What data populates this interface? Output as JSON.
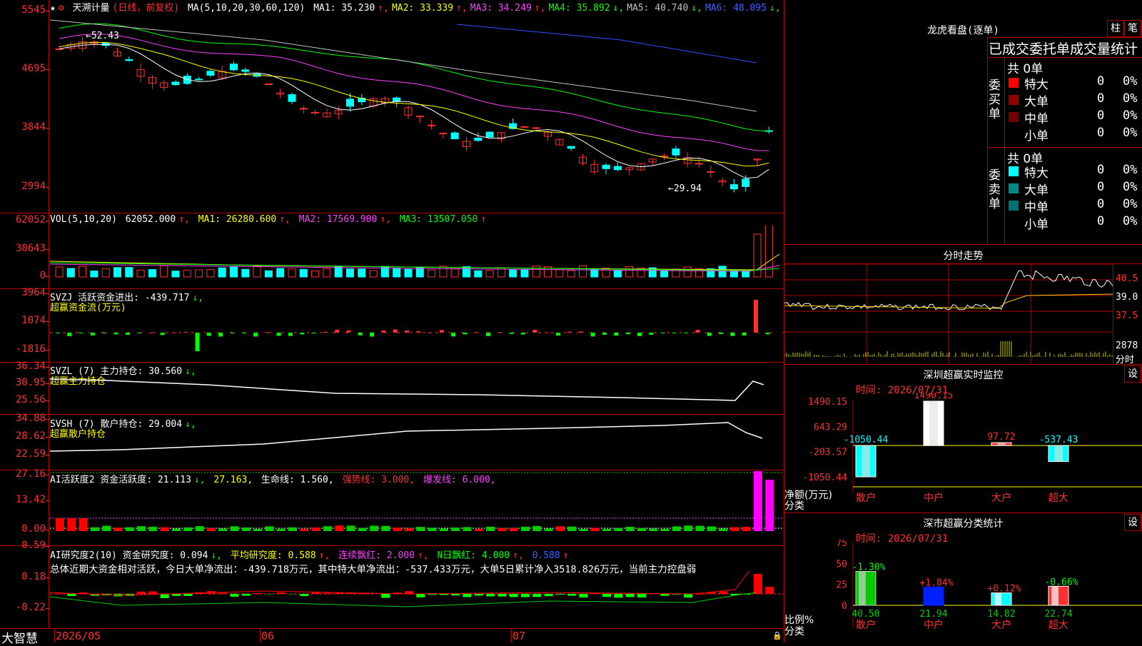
{
  "kline": {
    "star": "★",
    "title": "天溯计量",
    "mode": "(日线，前复权)",
    "ma_params": "MA(5,10,20,30,60,120)",
    "ma": [
      {
        "label": "MA1: 35.230",
        "arrow": "↑",
        "color": "#ffffff"
      },
      {
        "label": "MA2: 33.339",
        "arrow": "↑",
        "color": "#ffff00"
      },
      {
        "label": "MA3: 34.249",
        "arrow": "↑",
        "color": "#ff40ff"
      },
      {
        "label": "MA4: 35.892",
        "arrow": "↓",
        "color": "#00ff00"
      },
      {
        "label": "MA5: 40.740",
        "arrow": "↓",
        "color": "#c0c0c0"
      },
      {
        "label": "MA6: 48.095",
        "arrow": "↓",
        "color": "#4060ff"
      }
    ],
    "yticks": [
      "5545",
      "4695",
      "3844",
      "2994"
    ],
    "high_label": "52.43",
    "low_label": "29.94"
  },
  "vol": {
    "params": "VOL(5,10,20)",
    "value": "62052.000",
    "ma1": "MA1: 26280.600",
    "ma2": "MA2: 17569.900",
    "ma3": "MA3: 13507.050",
    "yticks": [
      "62052",
      "30643",
      "0"
    ]
  },
  "svzj": {
    "line1": "SVZJ  活跃资金进出: -439.717",
    "line1_arrow": "↓,",
    "line2": "超赢资金流(万元)",
    "yticks": [
      "3964",
      "1074",
      "-1816"
    ]
  },
  "svzl": {
    "line1": "SVZL (7) 主力持仓: 30.560",
    "line1_arrow": "↓,",
    "line2": "超赢主力持仓",
    "yticks": [
      "36.34",
      "30.95",
      "25.56"
    ]
  },
  "svsh": {
    "line1": "SVSH (7) 散户持仓: 29.004",
    "line1_arrow": "↓,",
    "line2": "超赢散户持仓",
    "yticks": [
      "34.88",
      "28.62",
      "22.59"
    ]
  },
  "ai1": {
    "label": "AI活跃度2 资金活跃度: 21.113",
    "arrow": "↓,",
    "v2": "27.163,",
    "v3": "生命线: 1.560,",
    "v4": "强势线: 3.000,",
    "v5": "爆发线: 6.000,",
    "yticks": [
      "27.16",
      "13.42",
      "0.00"
    ]
  },
  "ai2": {
    "label": "AI研究度2(10) 资金研究度: 0.094",
    "arrow": "↓,",
    "v2": "平均研究度: 0.588",
    "v2_arrow": "↑,",
    "v3": "连续飘红: 2.000",
    "v3_arrow": "↑,",
    "v4": "N日飘红: 4.000",
    "v4_arrow": "↑,",
    "v5": "0.588",
    "v5_arrow": "↑",
    "summary": "总体近期大资金相对活跃，今日大单净流出：-439.718万元，其中特大单净流出：-537.433万元，大单5日累计净入3518.826万元，当前主力控盘弱",
    "yticks": [
      "0.59",
      "0.18",
      "-0.22"
    ]
  },
  "xaxis": {
    "brand": "大智慧",
    "labels": [
      "2026/05",
      "06",
      "07"
    ]
  },
  "dragon": {
    "title": "龙虎看盘(逐单)",
    "btn1": "柱",
    "btn2": "笔",
    "header": "已成交委托单成交量统计",
    "buy_label": "委买单",
    "sell_label": "委卖单",
    "buy_total": "共 0单",
    "sell_total": "共 0单",
    "buy_rows": [
      {
        "name": "特大",
        "value": "0",
        "pct": "0%",
        "color": "#ff0000"
      },
      {
        "name": "大单",
        "value": "0",
        "pct": "0%",
        "color": "#900000"
      },
      {
        "name": "中单",
        "value": "0",
        "pct": "0%",
        "color": "#700000"
      },
      {
        "name": "小单",
        "value": "0",
        "pct": "0%",
        "color": ""
      }
    ],
    "sell_rows": [
      {
        "name": "特大",
        "value": "0",
        "pct": "0%",
        "color": "#00ffff"
      },
      {
        "name": "大单",
        "value": "0",
        "pct": "0%",
        "color": "#008888"
      },
      {
        "name": "中单",
        "value": "0",
        "pct": "0%",
        "color": "#007070"
      },
      {
        "name": "小单",
        "value": "0",
        "pct": "0%",
        "color": ""
      }
    ]
  },
  "intraday": {
    "title": "分时走势",
    "yticks": [
      "40.5",
      "39.0",
      "37.5"
    ],
    "vol_tick": "2878",
    "vol_unit": "分时"
  },
  "monitor": {
    "title": "深圳超赢实时监控",
    "set": "设",
    "time": "时间: 2026/07/31",
    "ylabel": "净额(万元)",
    "xlabel": "分类",
    "yticks": [
      "1490.15",
      "643.29",
      "-203.57",
      "-1050.44"
    ],
    "bars": [
      {
        "cat": "散户",
        "value": -1050.44,
        "label": "-1050.44",
        "color": "#00ffff"
      },
      {
        "cat": "中户",
        "value": 1490.15,
        "label": "1490.15",
        "color": "#ffffff"
      },
      {
        "cat": "大户",
        "value": 97.72,
        "label": "97.72",
        "color": "#ff3030"
      },
      {
        "cat": "超大",
        "value": -537.43,
        "label": "-537.43",
        "color": "#00ffff"
      }
    ]
  },
  "classify": {
    "title": "深市超赢分类统计",
    "set": "设",
    "time": "时间: 2026/07/31",
    "ylabel": "比例%",
    "xlabel": "分类",
    "yticks": [
      "75",
      "50",
      "25",
      "0"
    ],
    "bars": [
      {
        "cat": "散户",
        "value": 40.5,
        "label": "40.50",
        "change": "-1.30%",
        "color": "#00cc00",
        "edge": "#cccccc"
      },
      {
        "cat": "中户",
        "value": 21.94,
        "label": "21.94",
        "change": "+1.84%",
        "color": "#0020ff",
        "edge": "#0020ff"
      },
      {
        "cat": "大户",
        "value": 14.82,
        "label": "14.82",
        "change": "+0.12%",
        "color": "#00ffff",
        "edge": "#ffffff"
      },
      {
        "cat": "超大",
        "value": 22.74,
        "label": "22.74",
        "change": "-0.66%",
        "color": "#ff3030",
        "edge": "#ffffff"
      }
    ]
  }
}
